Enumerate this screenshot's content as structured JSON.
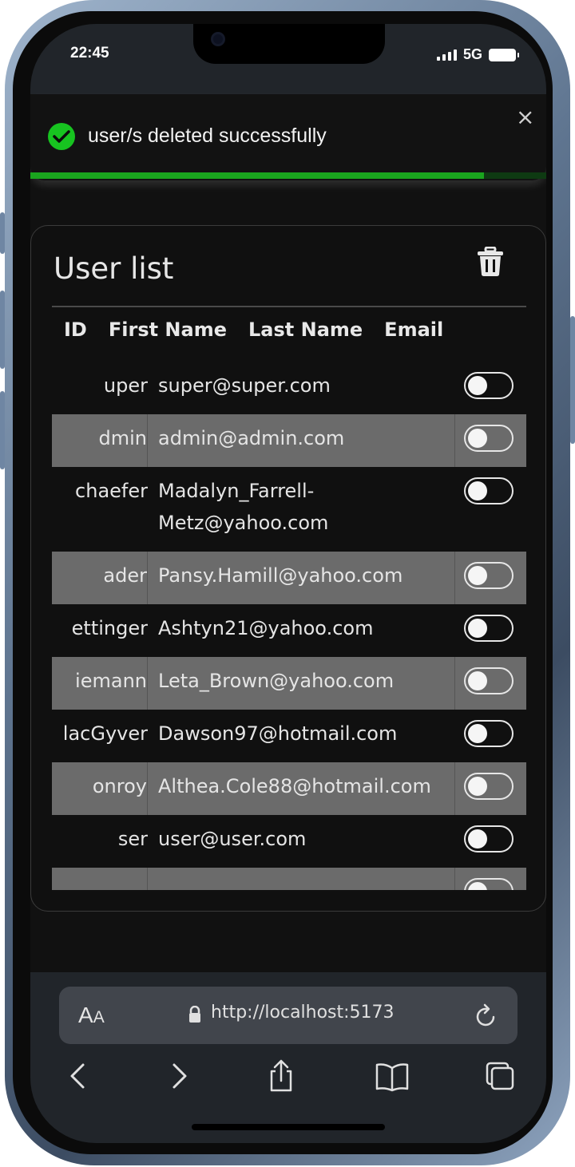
{
  "status_bar": {
    "time": "22:45",
    "network": "5G"
  },
  "toast": {
    "message": "user/s deleted successfully",
    "close_glyph": "×",
    "progress": 0.88,
    "icon": "check-circle-icon"
  },
  "card": {
    "title": "User list",
    "delete_icon": "trash-icon",
    "columns": [
      "ID",
      "First Name",
      "Last Name",
      "Email"
    ]
  },
  "users": [
    {
      "name": "uper",
      "email": "super@super.com",
      "shaded": false
    },
    {
      "name": "dmin",
      "email": "admin@admin.com",
      "shaded": true
    },
    {
      "name": "chaefer",
      "email": "Madalyn_Farrell-Metz@yahoo.com",
      "email_lines": [
        "Madalyn_Farrell-",
        "Metz@yahoo.com"
      ],
      "shaded": false
    },
    {
      "name": "ader",
      "email": "Pansy.Hamill@yahoo.com",
      "shaded": true
    },
    {
      "name": "ettinger",
      "email": "Ashtyn21@yahoo.com",
      "shaded": false
    },
    {
      "name": "iemann",
      "email": "Leta_Brown@yahoo.com",
      "shaded": true
    },
    {
      "name": "lacGyver",
      "email": "Dawson97@hotmail.com",
      "shaded": false
    },
    {
      "name": "onroy",
      "email": "Althea.Cole88@hotmail.com",
      "shaded": true
    },
    {
      "name": "ser",
      "email": "user@user.com",
      "shaded": false
    },
    {
      "name": "",
      "email": "",
      "shaded": true
    }
  ],
  "browser": {
    "text_size_label_big": "A",
    "text_size_label_small": "A",
    "url": "http://localhost:5173",
    "nav": [
      "back-icon",
      "forward-icon",
      "share-icon",
      "bookmarks-icon",
      "tabs-icon"
    ]
  },
  "colors": {
    "toast_green": "#17c320",
    "progress_green": "#1aa51e",
    "row_shade": "#6b6b6b"
  }
}
